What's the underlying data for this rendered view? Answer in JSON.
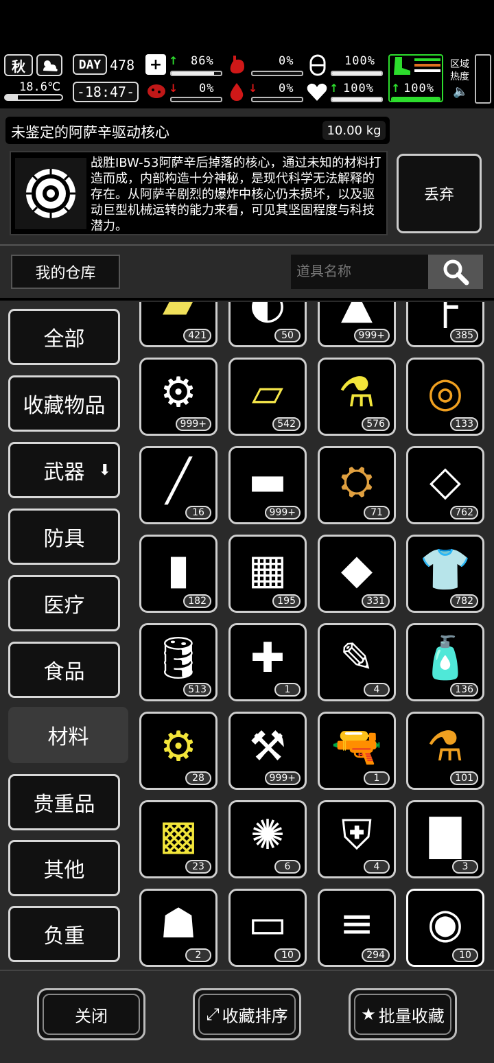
{
  "status": {
    "season": "秋",
    "temperature": "18.6℃",
    "day_label": "DAY",
    "day_number": "478",
    "clock": "-18:47-",
    "health": {
      "pct": "86%",
      "level": 0.86,
      "trend": "up"
    },
    "infection": {
      "pct": "0%",
      "level": 0,
      "trend": "down"
    },
    "hunger": {
      "pct": "0%",
      "level": 0
    },
    "thirst": {
      "pct": "0%",
      "level": 0,
      "trend": "down"
    },
    "energy": {
      "pct": "100%",
      "level": 1.0
    },
    "mood": {
      "pct": "100%",
      "level": 1.0,
      "trend": "up"
    },
    "stamina": {
      "pct": "100%",
      "level": 1.0,
      "trend": "up"
    },
    "area_heat_label": "区域热度",
    "accent_green": "#2ddd2d",
    "accent_red": "#e01818"
  },
  "item": {
    "name": "未鉴定的阿萨辛驱动核心",
    "weight": "10.00 kg",
    "description": "战胜IBW-53阿萨辛后掉落的核心，通过未知的材料打造而成，内部构造十分神秘，是现代科学无法解释的存在。从阿萨辛剧烈的爆炸中核心仍未损坏，以及驱动巨型机械运转的能力来看，可见其坚固程度与科技潜力。",
    "icon": "drive-core-icon",
    "discard_label": "丢弃"
  },
  "warehouse": {
    "title": "我的仓库",
    "search_placeholder": "道具名称"
  },
  "categories": [
    {
      "label": "全部"
    },
    {
      "label": "收藏物品"
    },
    {
      "label": "武器"
    },
    {
      "label": "防具"
    },
    {
      "label": "医疗"
    },
    {
      "label": "食品"
    },
    {
      "label": "材料",
      "active": true
    },
    {
      "label": "贵重品"
    },
    {
      "label": "其他"
    },
    {
      "label": "负重"
    }
  ],
  "grid": [
    {
      "icon": "metal-plate-icon",
      "count": "421",
      "color": "#f0e05a"
    },
    {
      "icon": "scrap-disc-icon",
      "count": "50",
      "color": "#ffffff"
    },
    {
      "icon": "liquid-spill-icon",
      "count": "999+",
      "color": "#ffffff"
    },
    {
      "icon": "handle-tool-icon",
      "count": "385",
      "color": "#ffffff"
    },
    {
      "icon": "electronic-parts-icon",
      "count": "999+",
      "color": "#ffffff"
    },
    {
      "icon": "cloth-bundle-icon",
      "count": "542",
      "color": "#f5e64a"
    },
    {
      "icon": "flask-icon",
      "count": "576",
      "color": "#f2e53a"
    },
    {
      "icon": "spool-icon",
      "count": "133",
      "color": "#f0a020"
    },
    {
      "icon": "rod-icon",
      "count": "16",
      "color": "#ffffff"
    },
    {
      "icon": "ingot-icon",
      "count": "999+",
      "color": "#ffffff"
    },
    {
      "icon": "engine-core-icon",
      "count": "71",
      "color": "#e0a040"
    },
    {
      "icon": "glass-sheet-icon",
      "count": "762",
      "color": "#ffffff"
    },
    {
      "icon": "wrapped-bar-icon",
      "count": "182",
      "color": "#ffffff"
    },
    {
      "icon": "bricks-icon",
      "count": "195",
      "color": "#ffffff"
    },
    {
      "icon": "plate-icon",
      "count": "331",
      "color": "#ffffff"
    },
    {
      "icon": "rag-shirt-icon",
      "count": "782",
      "color": "#ffffff"
    },
    {
      "icon": "fuel-barrel-icon",
      "count": "513",
      "color": "#ffffff"
    },
    {
      "icon": "gun-parts-icon",
      "count": "1",
      "color": "#ffffff"
    },
    {
      "icon": "soldering-icon",
      "count": "4",
      "color": "#ffffff"
    },
    {
      "icon": "spray-bottle-icon",
      "count": "136",
      "color": "#ffffff"
    },
    {
      "icon": "gears-icon",
      "count": "28",
      "color": "#f2e53a"
    },
    {
      "icon": "mechanism-parts-icon",
      "count": "999+",
      "color": "#ffffff"
    },
    {
      "icon": "pistol-icon",
      "count": "1",
      "color": "#ffffff"
    },
    {
      "icon": "potion-icon",
      "count": "101",
      "color": "#f0a020"
    },
    {
      "icon": "circuit-board-icon",
      "count": "23",
      "color": "#f2e53a"
    },
    {
      "icon": "turbine-icon",
      "count": "6",
      "color": "#ffffff"
    },
    {
      "icon": "armor-scrap-icon",
      "count": "4",
      "color": "#ffffff"
    },
    {
      "icon": "sack-icon",
      "count": "3",
      "color": "#ffffff"
    },
    {
      "icon": "hide-icon",
      "count": "2",
      "color": "#ffffff"
    },
    {
      "icon": "barrel-launcher-icon",
      "count": "10",
      "color": "#ffffff"
    },
    {
      "icon": "logs-icon",
      "count": "294",
      "color": "#ffffff"
    },
    {
      "icon": "drive-core-icon",
      "count": "10",
      "color": "#ffffff",
      "selected": true
    }
  ],
  "footer": {
    "close_label": "关闭",
    "sort_label": "收藏排序",
    "batch_label": "批量收藏"
  }
}
